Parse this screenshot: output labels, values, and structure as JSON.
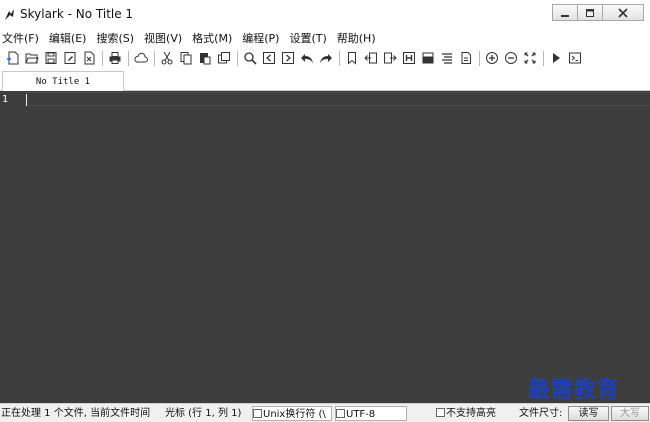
{
  "window": {
    "title": "Skylark - No Title 1"
  },
  "menu": {
    "items": [
      "文件(F)",
      "编辑(E)",
      "搜索(S)",
      "视图(V)",
      "格式(M)",
      "编程(P)",
      "设置(T)",
      "帮助(H)"
    ]
  },
  "toolbar": {
    "icons": [
      "new-file-icon",
      "open-folder-icon",
      "save-icon",
      "save-as-icon",
      "close-file-icon",
      "print-icon",
      "cloud-icon",
      "cut-icon",
      "copy-icon",
      "paste-icon",
      "clone-icon",
      "find-icon",
      "find-prev-icon",
      "find-next-icon",
      "undo-icon",
      "redo-icon",
      "bookmark-icon",
      "prev-bookmark-icon",
      "next-bookmark-icon",
      "heading-icon",
      "print-preview-icon",
      "list-icon",
      "document-icon",
      "zoom-in-icon",
      "zoom-out-icon",
      "fullscreen-icon",
      "run-icon",
      "console-icon"
    ]
  },
  "tabs": [
    {
      "label": "No Title 1",
      "active": true
    }
  ],
  "editor": {
    "line_numbers": [
      "1"
    ],
    "background": "#3d3d3d"
  },
  "status": {
    "processing": "正在处理 1 个文件, 当前文件时间",
    "cursor": "光标 (行 1, 列 1)",
    "line_ending": "Unix换行符 (\\",
    "encoding": "UTF-8",
    "highlight": "不支持高亮",
    "file_size_label": "文件尺寸:",
    "read_write": "读写",
    "uppercase": "大写"
  },
  "watermark": {
    "text": "最需教育"
  }
}
